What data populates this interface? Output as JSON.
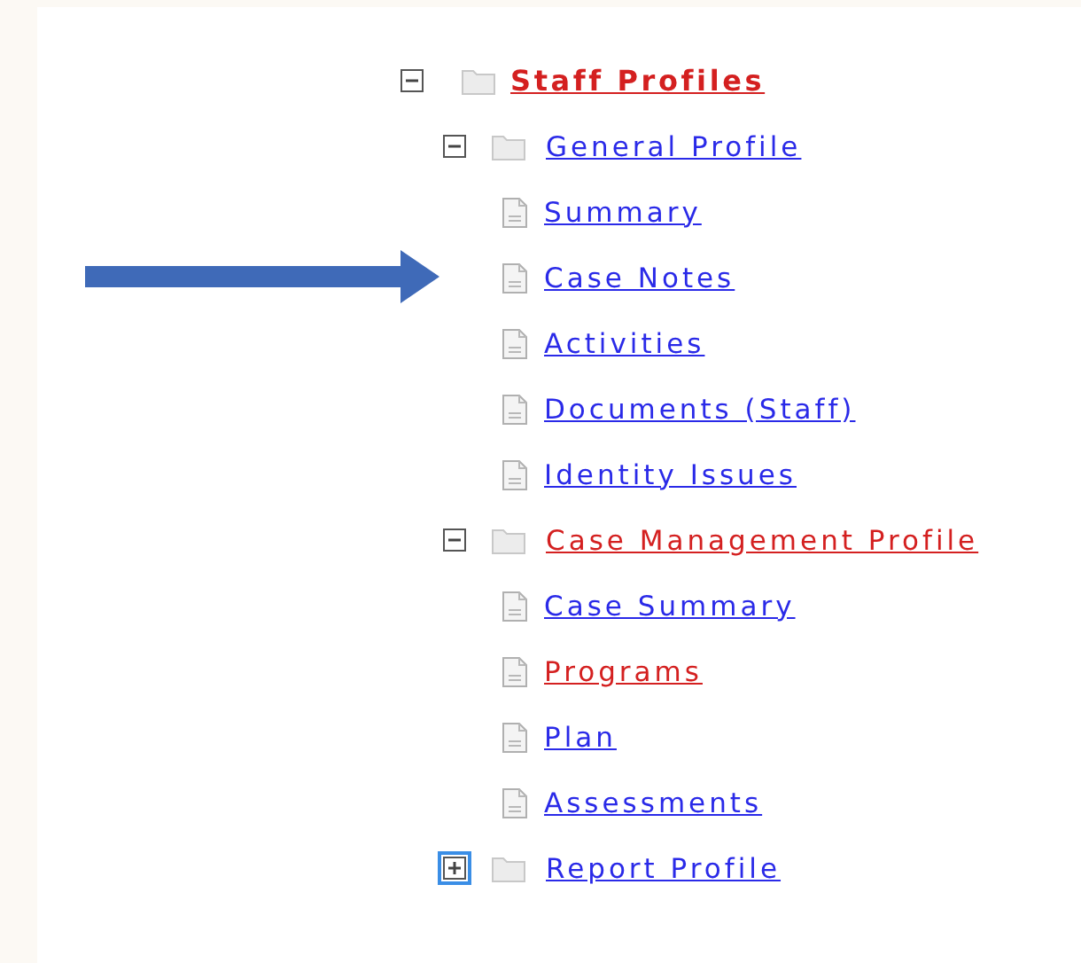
{
  "tree": {
    "label": "Staff Profiles",
    "kind": "folder",
    "expanded": true,
    "visited": true,
    "focused": false,
    "children": [
      {
        "label": "General Profile",
        "kind": "folder",
        "expanded": true,
        "visited": false,
        "focused": false,
        "children": [
          {
            "label": "Summary",
            "kind": "page",
            "visited": false,
            "pointed": false
          },
          {
            "label": "Case Notes",
            "kind": "page",
            "visited": false,
            "pointed": true
          },
          {
            "label": "Activities",
            "kind": "page",
            "visited": false,
            "pointed": false
          },
          {
            "label": "Documents (Staff)",
            "kind": "page",
            "visited": false,
            "pointed": false
          },
          {
            "label": "Identity Issues",
            "kind": "page",
            "visited": false,
            "pointed": false
          }
        ]
      },
      {
        "label": "Case Management Profile",
        "kind": "folder",
        "expanded": true,
        "visited": true,
        "focused": false,
        "children": [
          {
            "label": "Case Summary",
            "kind": "page",
            "visited": false,
            "pointed": false
          },
          {
            "label": "Programs",
            "kind": "page",
            "visited": true,
            "pointed": false
          },
          {
            "label": "Plan",
            "kind": "page",
            "visited": false,
            "pointed": false
          },
          {
            "label": "Assessments",
            "kind": "page",
            "visited": false,
            "pointed": false
          }
        ]
      },
      {
        "label": "Report Profile",
        "kind": "folder",
        "expanded": false,
        "visited": false,
        "focused": true
      }
    ]
  }
}
